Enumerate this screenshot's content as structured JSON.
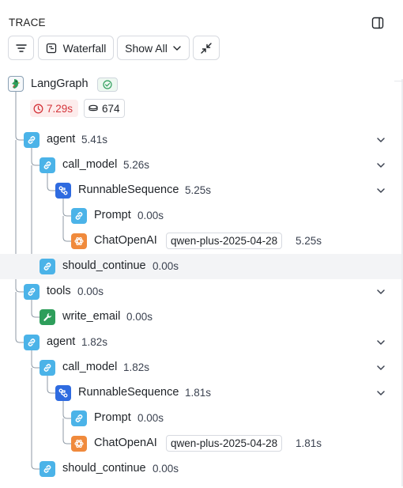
{
  "header": {
    "title": "TRACE",
    "panel_icon": "sidebar-panel-icon"
  },
  "toolbar": {
    "filter_icon": "filter-lines-icon",
    "waterfall_label": "Waterfall",
    "waterfall_icon": "waterfall-icon",
    "show_label": "Show All",
    "show_icon": "chevron-down-icon",
    "collapse_icon": "collapse-arrows-icon"
  },
  "root": {
    "name": "LangGraph",
    "icon": "parrot-icon",
    "status_icon": "check-circle-icon",
    "latency": "7.29s",
    "latency_icon": "clock-icon",
    "tokens": "674",
    "tokens_icon": "coin-stack-icon"
  },
  "nodes": [
    {
      "name": "agent",
      "time": "5.41s",
      "icon": "link-icon",
      "color": "#4bb3e8"
    },
    {
      "name": "call_model",
      "time": "5.26s",
      "icon": "link-icon",
      "color": "#4bb3e8"
    },
    {
      "name": "RunnableSequence",
      "time": "5.25s",
      "icon": "sequence-icon",
      "color": "#2f6be0"
    },
    {
      "name": "Prompt",
      "time": "0.00s",
      "icon": "link-icon",
      "color": "#4bb3e8"
    },
    {
      "name": "ChatOpenAI",
      "model": "qwen-plus-2025-04-28",
      "time": "5.25s",
      "icon": "openai-icon",
      "color": "#f08a3c"
    },
    {
      "name": "should_continue",
      "time": "0.00s",
      "icon": "link-icon",
      "color": "#4bb3e8"
    },
    {
      "name": "tools",
      "time": "0.00s",
      "icon": "link-icon",
      "color": "#4bb3e8"
    },
    {
      "name": "write_email",
      "time": "0.00s",
      "icon": "wrench-icon",
      "color": "#2e9e5b"
    },
    {
      "name": "agent",
      "time": "1.82s",
      "icon": "link-icon",
      "color": "#4bb3e8"
    },
    {
      "name": "call_model",
      "time": "1.82s",
      "icon": "link-icon",
      "color": "#4bb3e8"
    },
    {
      "name": "RunnableSequence",
      "time": "1.81s",
      "icon": "sequence-icon",
      "color": "#2f6be0"
    },
    {
      "name": "Prompt",
      "time": "0.00s",
      "icon": "link-icon",
      "color": "#4bb3e8"
    },
    {
      "name": "ChatOpenAI",
      "model": "qwen-plus-2025-04-28",
      "time": "1.81s",
      "icon": "openai-icon",
      "color": "#f08a3c"
    },
    {
      "name": "should_continue",
      "time": "0.00s",
      "icon": "link-icon",
      "color": "#4bb3e8"
    }
  ]
}
